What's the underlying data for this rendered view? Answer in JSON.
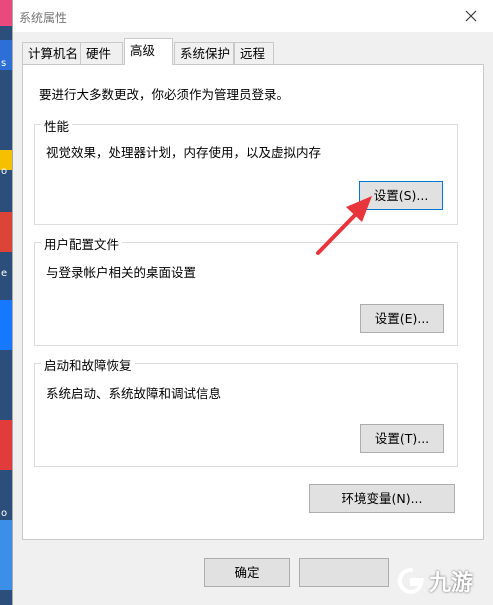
{
  "window": {
    "title": "系统属性"
  },
  "tabs": [
    {
      "label": "计算机名"
    },
    {
      "label": "硬件"
    },
    {
      "label": "高级",
      "active": true
    },
    {
      "label": "系统保护"
    },
    {
      "label": "远程"
    }
  ],
  "notice": "要进行大多数更改，你必须作为管理员登录。",
  "groups": {
    "performance": {
      "title": "性能",
      "desc": "视觉效果，处理器计划，内存使用，以及虚拟内存",
      "button": "设置(S)..."
    },
    "profile": {
      "title": "用户配置文件",
      "desc": "与登录帐户相关的桌面设置",
      "button": "设置(E)..."
    },
    "startup": {
      "title": "启动和故障恢复",
      "desc": "系统启动、系统故障和调试信息",
      "button": "设置(T)..."
    }
  },
  "env_button": "环境变量(N)...",
  "footer": {
    "ok": "确定"
  },
  "watermark": {
    "text": "九游"
  },
  "desktop_strip": {
    "letters": [
      "s",
      "o",
      "e",
      "o"
    ]
  },
  "colors": {
    "accent": "#0078d7",
    "annotation_arrow": "#e8343b"
  }
}
